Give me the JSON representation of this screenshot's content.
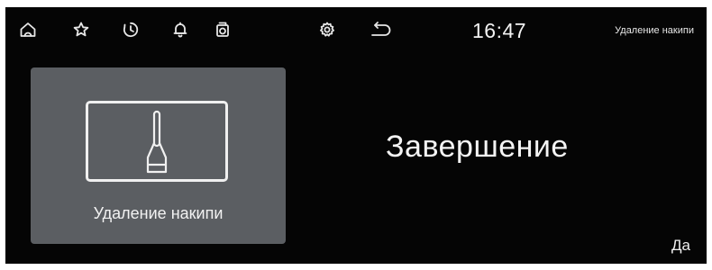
{
  "status_bar": {
    "icons": [
      {
        "name": "home-icon"
      },
      {
        "name": "favorites-star-icon"
      },
      {
        "name": "timer-icon"
      },
      {
        "name": "notification-bell-icon"
      },
      {
        "name": "appliance-icon"
      },
      {
        "name": "settings-gear-icon"
      },
      {
        "name": "back-arrow-icon"
      }
    ],
    "time": "16:47",
    "program_title": "Удаление накипи"
  },
  "program_tile": {
    "icon": "descaling-brush-icon",
    "label": "Удаление накипи"
  },
  "main": {
    "status_message": "Завершение",
    "confirm_label": "Да"
  },
  "colors": {
    "screen_background": "#050505",
    "tile_background": "#5b5e62",
    "foreground": "#f0f0f0"
  }
}
